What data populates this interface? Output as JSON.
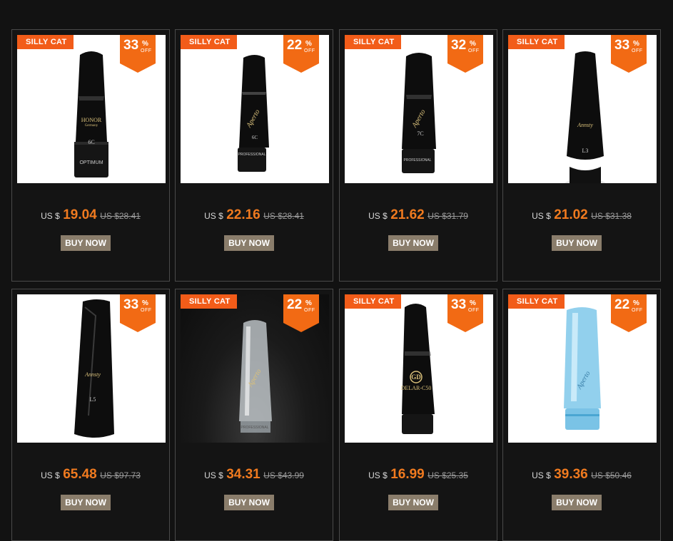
{
  "brand_badge": "SILLY CAT",
  "buy_label": "BUY NOW",
  "off_label": "OFF",
  "percent_symbol": "%",
  "currency": "US $",
  "products": [
    {
      "discount": "33",
      "price": "19.04",
      "old_price": "US $28.41",
      "has_brand": true,
      "mouthpiece_text": [
        "HONOR",
        "Germany",
        "6C",
        "OPTIMUM"
      ]
    },
    {
      "discount": "22",
      "price": "22.16",
      "old_price": "US $28.41",
      "has_brand": true,
      "mouthpiece_text": [
        "Aperto",
        "6C",
        "PROFESSIONAL"
      ]
    },
    {
      "discount": "32",
      "price": "21.62",
      "old_price": "US $31.79",
      "has_brand": true,
      "mouthpiece_text": [
        "Aperto",
        "7C",
        "PROFESSIONAL"
      ]
    },
    {
      "discount": "33",
      "price": "21.02",
      "old_price": "US $31.38",
      "has_brand": true,
      "mouthpiece_text": [
        "Annsty",
        "L3"
      ]
    },
    {
      "discount": "33",
      "price": "65.48",
      "old_price": "US $97.73",
      "has_brand": false,
      "mouthpiece_text": [
        "Annsty",
        "L5"
      ]
    },
    {
      "discount": "22",
      "price": "34.31",
      "old_price": "US $43.99",
      "has_brand": true,
      "mouthpiece_text": [
        "Aperto",
        "PROFESSIONAL"
      ]
    },
    {
      "discount": "33",
      "price": "16.99",
      "old_price": "US $25.35",
      "has_brand": true,
      "mouthpiece_text": [
        "GD",
        "DELAR-C50"
      ]
    },
    {
      "discount": "22",
      "price": "39.36",
      "old_price": "US $50.46",
      "has_brand": true,
      "mouthpiece_text": [
        "Aperto"
      ]
    }
  ],
  "colors": {
    "page_bg": "#121212",
    "card_border": "#4a4a4a",
    "badge_orange": "#f25c19",
    "price_orange": "#f07a1f",
    "button_bg": "#8a7d6b"
  }
}
